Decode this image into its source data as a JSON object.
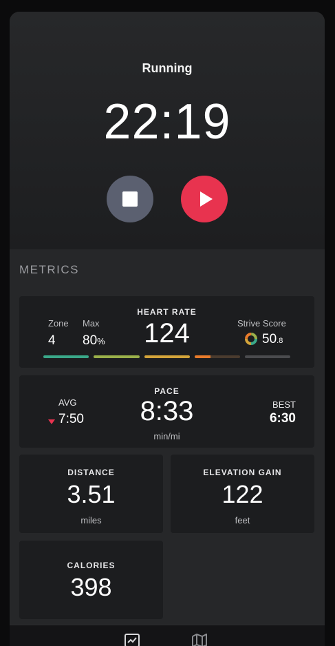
{
  "workout": {
    "activity": "Running",
    "elapsed": "22:19"
  },
  "controls": {
    "stop_icon": "stop-icon",
    "play_icon": "play-icon",
    "play_color": "#e8334f",
    "stop_color": "#5b6070"
  },
  "metrics": {
    "section_title": "METRICS",
    "heart_rate": {
      "title": "HEART RATE",
      "value": "124",
      "zone_label": "Zone",
      "zone_value": "4",
      "max_label": "Max",
      "max_value": "80",
      "max_unit": "%",
      "strive_label": "Strive Score",
      "strive_value": "50",
      "strive_decimal": ".8",
      "zone_colors": [
        "#3aa889",
        "#9ab04a",
        "#d3a43a",
        "#e87b2b",
        "#4a4b4e"
      ]
    },
    "pace": {
      "title": "PACE",
      "value": "8:33",
      "unit": "min/mi",
      "avg_label": "AVG",
      "avg_value": "7:50",
      "best_label": "BEST",
      "best_value": "6:30"
    },
    "distance": {
      "title": "DISTANCE",
      "value": "3.51",
      "unit": "miles"
    },
    "elevation": {
      "title": "ELEVATION GAIN",
      "value": "122",
      "unit": "feet"
    },
    "calories": {
      "title": "CALORIES",
      "value": "398"
    }
  },
  "bottom_nav": {
    "items": [
      "chart-icon",
      "map-icon"
    ]
  }
}
